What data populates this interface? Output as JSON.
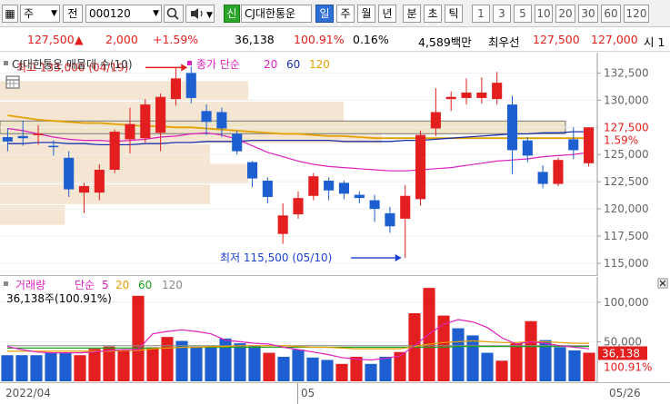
{
  "toolbar": {
    "market_dropdown": "주",
    "current_label": "전",
    "stock_code": "000120",
    "search_icon": "search-icon",
    "sound_icon": "speaker-icon",
    "new_label": "신",
    "stock_name": "CJ대한통운",
    "periods": [
      "일",
      "주",
      "월",
      "년",
      "분",
      "초",
      "틱"
    ],
    "selected_period": "일",
    "intervals": [
      "1",
      "3",
      "5",
      "10",
      "20",
      "30",
      "60",
      "120"
    ]
  },
  "quote": {
    "price": "127,500",
    "arrow": "▲",
    "change": "2,000",
    "change_pct": "+1.59%",
    "volume": "36,138",
    "volume_ratio": "100.91%",
    "turnover": "0.16%",
    "trade_value": "4,589백만",
    "best_label": "최우선",
    "best_ask": "127,500",
    "best_bid": "127,000",
    "trailing": "시 1"
  },
  "price_pane": {
    "title": "CJ대한통운 매물대 수(10)",
    "ma_label": "종가 단순",
    "ma_periods": [
      "20",
      "60",
      "120"
    ],
    "ma_colors": [
      "#e020c0",
      "#1d2fa8",
      "#e6a000"
    ],
    "high_annotation": "최고 133,000 (04/19)",
    "low_annotation": "최저 115,500 (05/10)",
    "current_price_tag": "127,500",
    "current_pct_tag": "1.59%",
    "y_ticks": [
      "132,500",
      "130,000",
      "127,500",
      "125,000",
      "122,500",
      "120,000",
      "117,500",
      "115,000"
    ],
    "calendar_icon": "calendar-icon"
  },
  "volume_pane": {
    "title": "거래량",
    "ma_label": "단순",
    "ma_periods": [
      "5",
      "20",
      "60",
      "120"
    ],
    "ma_colors": [
      "#e020c0",
      "#e6a000",
      "#20a020",
      "#888888"
    ],
    "current_info": "36,138주(100.91%)",
    "y_ticks": [
      "100,000",
      "50,000"
    ],
    "current_volume_tag": "36,138",
    "current_pct_tag": "100.91%",
    "close_icon": "close-icon"
  },
  "x_axis": {
    "labels": [
      "2022/04",
      "05",
      "05/26"
    ]
  },
  "chart_data": {
    "type": "candlestick",
    "title": "CJ대한통운 매물대 수(10)",
    "ylim": [
      114000,
      134200
    ],
    "colors": {
      "up": "#e31e1e",
      "down": "#1d5fd0",
      "flat": "#1d5fd0"
    },
    "candles": [
      {
        "o": 126600,
        "h": 127400,
        "l": 125300,
        "c": 126200
      },
      {
        "o": 126700,
        "h": 128100,
        "l": 125800,
        "c": 126500
      },
      {
        "o": 126800,
        "h": 127700,
        "l": 125900,
        "c": 126900
      },
      {
        "o": 125800,
        "h": 126300,
        "l": 124900,
        "c": 125700
      },
      {
        "o": 124700,
        "h": 125300,
        "l": 121100,
        "c": 121800
      },
      {
        "o": 121500,
        "h": 122400,
        "l": 119600,
        "c": 122100
      },
      {
        "o": 121500,
        "h": 124100,
        "l": 120800,
        "c": 123600
      },
      {
        "o": 123600,
        "h": 127300,
        "l": 123300,
        "c": 127100
      },
      {
        "o": 126400,
        "h": 129300,
        "l": 125100,
        "c": 127800
      },
      {
        "o": 126500,
        "h": 130100,
        "l": 126100,
        "c": 129600
      },
      {
        "o": 127000,
        "h": 130600,
        "l": 125300,
        "c": 130300
      },
      {
        "o": 130100,
        "h": 133000,
        "l": 129500,
        "c": 132000
      },
      {
        "o": 132500,
        "h": 133100,
        "l": 129700,
        "c": 130200
      },
      {
        "o": 129000,
        "h": 129600,
        "l": 126800,
        "c": 128000
      },
      {
        "o": 128900,
        "h": 129300,
        "l": 126600,
        "c": 127400
      },
      {
        "o": 126900,
        "h": 127200,
        "l": 125000,
        "c": 125300
      },
      {
        "o": 124300,
        "h": 124400,
        "l": 122000,
        "c": 122800
      },
      {
        "o": 122600,
        "h": 122900,
        "l": 120500,
        "c": 121100
      },
      {
        "o": 117700,
        "h": 120500,
        "l": 116800,
        "c": 119400
      },
      {
        "o": 119500,
        "h": 121600,
        "l": 119100,
        "c": 121000
      },
      {
        "o": 121200,
        "h": 123300,
        "l": 120800,
        "c": 123000
      },
      {
        "o": 122600,
        "h": 122900,
        "l": 120800,
        "c": 121700
      },
      {
        "o": 122400,
        "h": 122600,
        "l": 120900,
        "c": 121400
      },
      {
        "o": 121300,
        "h": 121600,
        "l": 120500,
        "c": 121000
      },
      {
        "o": 120800,
        "h": 121300,
        "l": 118800,
        "c": 120000
      },
      {
        "o": 119600,
        "h": 120200,
        "l": 117800,
        "c": 118400
      },
      {
        "o": 119100,
        "h": 122200,
        "l": 115500,
        "c": 121200
      },
      {
        "o": 120900,
        "h": 127200,
        "l": 120300,
        "c": 126800
      },
      {
        "o": 127400,
        "h": 131100,
        "l": 126700,
        "c": 128900
      },
      {
        "o": 130100,
        "h": 130800,
        "l": 129000,
        "c": 130300
      },
      {
        "o": 130200,
        "h": 132000,
        "l": 129600,
        "c": 130700
      },
      {
        "o": 130200,
        "h": 132100,
        "l": 129700,
        "c": 130700
      },
      {
        "o": 130100,
        "h": 132600,
        "l": 129600,
        "c": 131600
      },
      {
        "o": 129600,
        "h": 130400,
        "l": 123200,
        "c": 125400
      },
      {
        "o": 126300,
        "h": 126600,
        "l": 124300,
        "c": 124900
      },
      {
        "o": 123400,
        "h": 124000,
        "l": 121900,
        "c": 122300
      },
      {
        "o": 122300,
        "h": 124700,
        "l": 122100,
        "c": 124500
      },
      {
        "o": 126400,
        "h": 127500,
        "l": 124600,
        "c": 125400
      },
      {
        "o": 124200,
        "h": 127500,
        "l": 123900,
        "c": 127500
      }
    ],
    "ma20": [
      127400,
      127200,
      126900,
      126600,
      126400,
      126300,
      126300,
      126200,
      126300,
      126400,
      126600,
      126700,
      126900,
      127000,
      126800,
      126400,
      125800,
      125200,
      124800,
      124400,
      124100,
      123900,
      123800,
      123700,
      123600,
      123500,
      123500,
      123600,
      123700,
      123800,
      124000,
      124200,
      124400,
      124500,
      124600,
      124800,
      124900,
      125000,
      125200
    ],
    "ma60": [
      126000,
      126000,
      126100,
      126100,
      126000,
      126000,
      125900,
      125900,
      125900,
      126000,
      126000,
      126100,
      126100,
      126200,
      126200,
      126200,
      126300,
      126300,
      126300,
      126300,
      126300,
      126300,
      126200,
      126200,
      126200,
      126200,
      126300,
      126300,
      126400,
      126500,
      126600,
      126700,
      126800,
      126900,
      126900,
      127000,
      127000,
      127100,
      127100
    ],
    "ma120": [
      128600,
      128400,
      128200,
      128100,
      128000,
      127900,
      127900,
      127800,
      127700,
      127600,
      127600,
      127500,
      127500,
      127400,
      127300,
      127200,
      127100,
      127000,
      126900,
      126900,
      126800,
      126700,
      126700,
      126600,
      126500,
      126500,
      126500,
      126500,
      126500,
      126500,
      126500,
      126500,
      126500,
      126500,
      126500,
      126500,
      126500,
      126500,
      126500
    ],
    "volume_profile": [
      {
        "price": 130800,
        "width_frac": 0.65
      },
      {
        "price": 128900,
        "width_frac": 0.9
      },
      {
        "price": 126900,
        "width_frac": 1.0
      },
      {
        "price": 125000,
        "width_frac": 0.55
      },
      {
        "price": 123200,
        "width_frac": 0.65
      },
      {
        "price": 121300,
        "width_frac": 0.55
      },
      {
        "price": 119400,
        "width_frac": 0.17
      }
    ],
    "volume_ylim": [
      0,
      125000
    ],
    "volumes": [
      {
        "v": 33000,
        "up": false
      },
      {
        "v": 33000,
        "up": false
      },
      {
        "v": 33000,
        "up": false
      },
      {
        "v": 36000,
        "up": false
      },
      {
        "v": 36000,
        "up": false
      },
      {
        "v": 33000,
        "up": true
      },
      {
        "v": 41000,
        "up": true
      },
      {
        "v": 44000,
        "up": true
      },
      {
        "v": 40000,
        "up": true
      },
      {
        "v": 108000,
        "up": true
      },
      {
        "v": 43000,
        "up": true
      },
      {
        "v": 56000,
        "up": true
      },
      {
        "v": 51000,
        "up": false
      },
      {
        "v": 44000,
        "up": false
      },
      {
        "v": 44000,
        "up": false
      },
      {
        "v": 54000,
        "up": false
      },
      {
        "v": 48000,
        "up": false
      },
      {
        "v": 45000,
        "up": false
      },
      {
        "v": 36000,
        "up": true
      },
      {
        "v": 31000,
        "up": false
      },
      {
        "v": 40000,
        "up": false
      },
      {
        "v": 30000,
        "up": false
      },
      {
        "v": 27000,
        "up": false
      },
      {
        "v": 22000,
        "up": true
      },
      {
        "v": 31000,
        "up": true
      },
      {
        "v": 22000,
        "up": false
      },
      {
        "v": 31000,
        "up": false
      },
      {
        "v": 37000,
        "up": true
      },
      {
        "v": 86000,
        "up": true
      },
      {
        "v": 118000,
        "up": true
      },
      {
        "v": 83000,
        "up": true
      },
      {
        "v": 67000,
        "up": false
      },
      {
        "v": 58000,
        "up": false
      },
      {
        "v": 36000,
        "up": false
      },
      {
        "v": 26000,
        "up": true
      },
      {
        "v": 48000,
        "up": true
      },
      {
        "v": 76000,
        "up": true
      },
      {
        "v": 52000,
        "up": false
      },
      {
        "v": 43000,
        "up": false
      },
      {
        "v": 39000,
        "up": false
      },
      {
        "v": 36138,
        "up": true
      }
    ],
    "volume_ma5": [
      44000,
      40000,
      37000,
      36000,
      36000,
      36000,
      37000,
      39000,
      40000,
      40000,
      60000,
      63000,
      65000,
      63000,
      60000,
      52000,
      50000,
      48000,
      47000,
      43000,
      40000,
      37000,
      34000,
      30000,
      28000,
      27000,
      29000,
      32000,
      45000,
      60000,
      72000,
      78000,
      75000,
      68000,
      55000,
      47000,
      50000,
      48000,
      45000,
      43000,
      41000
    ],
    "volume_ma20": [
      38000,
      38000,
      38000,
      38000,
      38000,
      38000,
      38000,
      38000,
      39000,
      39000,
      41000,
      42000,
      43000,
      43000,
      44000,
      44000,
      45000,
      45000,
      45000,
      45000,
      44000,
      43000,
      43000,
      42000,
      41000,
      41000,
      41000,
      41000,
      44000,
      47000,
      49000,
      50000,
      51000,
      50000,
      49000,
      49000,
      50000,
      50000,
      49000,
      48000,
      48000
    ],
    "volume_ma60": [
      42000,
      42000,
      42000,
      42000,
      42000,
      42000,
      42000,
      42000,
      42000,
      42000,
      42000,
      42000,
      43000,
      43000,
      43000,
      43000,
      43000,
      43000,
      43000,
      43000,
      43000,
      43000,
      43000,
      43000,
      43000,
      43000,
      43000,
      43000,
      43000,
      43000,
      43000,
      44000,
      44000,
      44000,
      44000,
      44000,
      44000,
      44000,
      44000,
      44000,
      44000
    ],
    "volume_ma120": [
      45000,
      45000,
      45000,
      45000,
      45000,
      45000,
      45000,
      45000,
      45000,
      45000,
      45000,
      45000,
      45000,
      45000,
      45000,
      45000,
      45000,
      45000,
      45000,
      45000,
      45000,
      45000,
      45000,
      45000,
      45000,
      45000,
      45000,
      45000,
      45000,
      45000,
      45000,
      45000,
      45000,
      45000,
      45000,
      45000,
      45000,
      45000,
      45000,
      45000,
      45000
    ]
  }
}
